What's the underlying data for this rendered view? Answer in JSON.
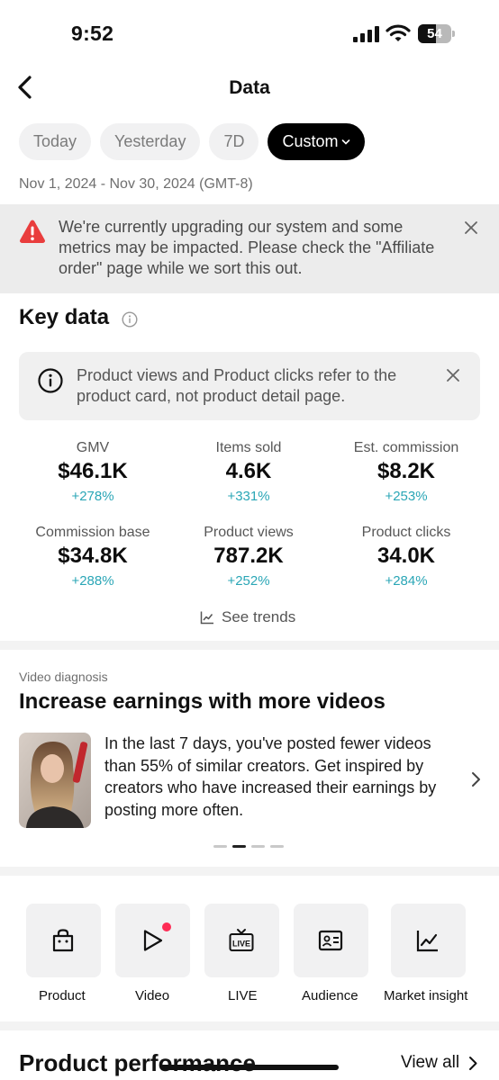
{
  "status_bar": {
    "time": "9:52",
    "battery_level": "54",
    "battery_percent": 54
  },
  "nav": {
    "title": "Data",
    "back_icon": "chevron-left-icon"
  },
  "filters": {
    "chips": [
      "Today",
      "Yesterday",
      "7D",
      "Custom"
    ],
    "selected": "Custom"
  },
  "date_range": "Nov 1, 2024 - Nov 30, 2024 (GMT-8)",
  "alert": {
    "icon": "warning-icon",
    "color": "#e93d3d",
    "text": "We're currently upgrading our system and some metrics may be impacted. Please check the \"Affiliate order\" page while we sort this out."
  },
  "key_data": {
    "title": "Key data",
    "note": "Product views and Product clicks refer to the product card, not product detail page.",
    "metrics": [
      {
        "label": "GMV",
        "value": "$46.1K",
        "change": "+278%"
      },
      {
        "label": "Items sold",
        "value": "4.6K",
        "change": "+331%"
      },
      {
        "label": "Est. commission",
        "value": "$8.2K",
        "change": "+253%"
      },
      {
        "label": "Commission base",
        "value": "$34.8K",
        "change": "+288%"
      },
      {
        "label": "Product views",
        "value": "787.2K",
        "change": "+252%"
      },
      {
        "label": "Product clicks",
        "value": "34.0K",
        "change": "+284%"
      }
    ],
    "trend_color": "#2aa6b6",
    "see_trends": "See trends"
  },
  "video_diagnosis": {
    "kicker": "Video diagnosis",
    "title": "Increase earnings with more videos",
    "text": "In the last 7 days, you've posted fewer videos than 55% of similar creators. Get inspired by creators who have increased their earnings by posting more often.",
    "carousel_pages": 4,
    "carousel_active": 2
  },
  "tools": [
    {
      "label": "Product",
      "icon": "shopping-bag-icon"
    },
    {
      "label": "Video",
      "icon": "play-icon",
      "badge": true
    },
    {
      "label": "LIVE",
      "icon": "live-tv-icon"
    },
    {
      "label": "Audience",
      "icon": "id-card-icon"
    },
    {
      "label": "Market insight",
      "icon": "line-chart-icon"
    }
  ],
  "product_performance": {
    "title": "Product performance",
    "view_all": "View all"
  }
}
